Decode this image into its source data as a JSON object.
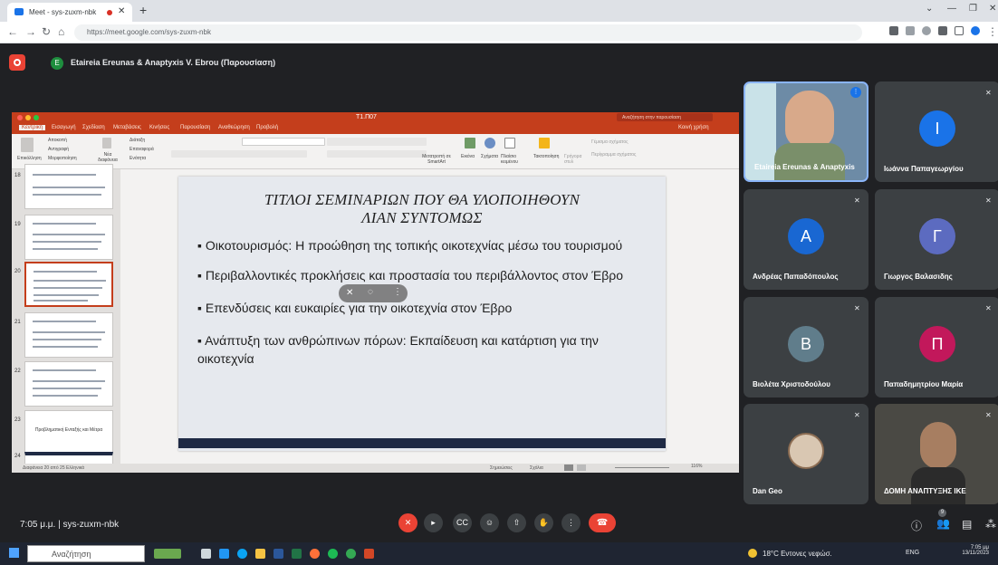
{
  "browser": {
    "tab_title": "Meet - sys-zuxm-nbk",
    "url": "https://meet.google.com/sys-zuxm-nbk"
  },
  "meet": {
    "presenter_label": "Etaireia Ereunas & Anaptyxis V. Ebrou (Παρουσίαση)",
    "presenter_initial": "E",
    "time_code": "7:05 μ.μ.  |  sys-zuxm-nbk",
    "people_count": "9"
  },
  "ppt": {
    "filename": "T1.П07",
    "search_placeholder": "Αναζήτηση στην παρουσίαση",
    "share_label": "Κοινή χρήση",
    "menu_tabs": [
      "Κεντρική",
      "Εισαγωγή",
      "Σχεδίαση",
      "Μεταβάσεις",
      "Κινήσεις",
      "Παρουσίαση",
      "Αναθεώρηση",
      "Προβολή"
    ],
    "ribbon": {
      "paste": "Επικόλληση",
      "cut": "Αποκοπή",
      "copy": "Αντιγραφή",
      "format": "Μορφοποίηση",
      "new_slide": "Νέα διαφάνεια",
      "layout": "Διάταξη",
      "reset": "Επαναφορά",
      "section": "Ενότητα",
      "convert_smartart": "Μετατροπή σε SmartArt",
      "picture": "Εικόνα",
      "shapes": "Σχήματα",
      "textbox": "Πλαίσιο κειμένου",
      "arrange": "Τακτοποίηση",
      "quick_styles": "Γρήγορα στυλ",
      "shape_fill": "Γέμισμα σχήματος",
      "shape_outline": "Περίγραμμα σχήματος"
    },
    "thumb_numbers": [
      "18",
      "19",
      "20",
      "21",
      "22",
      "23",
      "24"
    ],
    "thumb_23_text": "Προβληματική Ενταξής και Μέτρα",
    "status_left": "Διαφάνεια 20 από 25   Ελληνικά",
    "status_notes": "Σημειώσεις",
    "status_comments": "Σχόλια",
    "zoom": "116%",
    "slide": {
      "title_line1": "ΤΙΤΛΟΙ ΣΕΜΙΝΑΡΙΩΝ ΠΟΥ ΘΑ ΥΛΟΠΟΙΗΘΟΥΝ",
      "title_line2": "ΛΙΑΝ ΣΥΝΤΟΜΩΣ",
      "bullets": [
        "Οικοτουρισμός: Η προώθηση της τοπικής οικοτεχνίας μέσω του τουρισμού",
        "Περιβαλλοντικές προκλήσεις και προστασία του περιβάλλοντος στον Έβρο",
        "Επενδύσεις και ευκαιρίες για την οικοτεχνία στον Έβρο",
        "Ανάπτυξη των ανθρώπινων πόρων: Εκπαίδευση και κατάρτιση για την οικοτεχνία"
      ]
    }
  },
  "participants": [
    {
      "name": "Etaireia Ereunas & Anaptyxis",
      "initial": "",
      "color": "#5a7fa6"
    },
    {
      "name": "Ιωάννα Παπαγεωργίου",
      "initial": "Ι",
      "color": "#1a73e8"
    },
    {
      "name": "Ανδρέας Παπαδόπουλος",
      "initial": "Α",
      "color": "#1967d2"
    },
    {
      "name": "Γιωργος Βαλασιδης",
      "initial": "Γ",
      "color": "#5c6bc0"
    },
    {
      "name": "Βιολέτα Χριστοδούλου",
      "initial": "Β",
      "color": "#607d8b"
    },
    {
      "name": "Παπαδημητρίου Μαρία",
      "initial": "Π",
      "color": "#c2185b"
    },
    {
      "name": "Dan Geo",
      "initial": "",
      "color": "#3c4043"
    },
    {
      "name": "ΔΟΜΗ ΑΝΑΠΤΥΞΗΣ ΙΚΕ",
      "initial": "",
      "color": "#3b3a35"
    }
  ],
  "taskbar": {
    "search_placeholder": "Αναζήτηση",
    "weather": "18°C  Εντονες νεφώσ.",
    "lang": "ENG",
    "clock_time": "7:05 μμ",
    "clock_date": "13/11/2023"
  }
}
